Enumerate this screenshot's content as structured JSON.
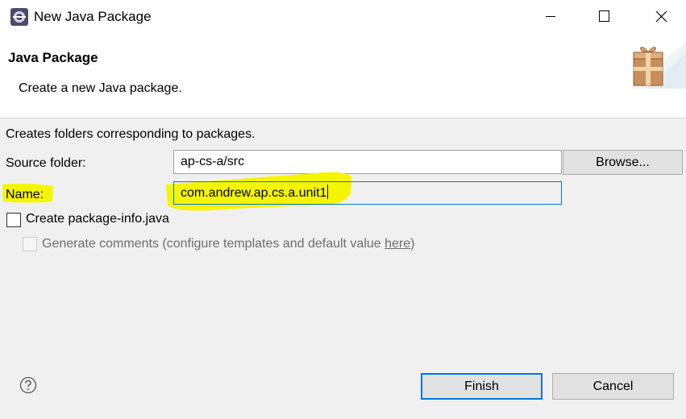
{
  "window": {
    "title": "New Java Package"
  },
  "header": {
    "title": "Java Package",
    "description": "Create a new Java package."
  },
  "form": {
    "intro": "Creates folders corresponding to packages.",
    "source_folder_label": "Source folder:",
    "source_folder_value": "ap-cs-a/src",
    "browse_label": "Browse...",
    "name_label": "Name:",
    "name_value": "com.andrew.ap.cs.a.unit1",
    "create_package_info_label": "Create package-info.java",
    "create_package_info_checked": false,
    "generate_comments_label": "Generate comments (configure templates and default value ",
    "generate_comments_link": "here",
    "generate_comments_suffix": ")",
    "generate_comments_checked": false,
    "generate_comments_enabled": false
  },
  "footer": {
    "finish_label": "Finish",
    "cancel_label": "Cancel"
  },
  "colors": {
    "highlight": "#f5f500",
    "focus_border": "#0078d7"
  }
}
